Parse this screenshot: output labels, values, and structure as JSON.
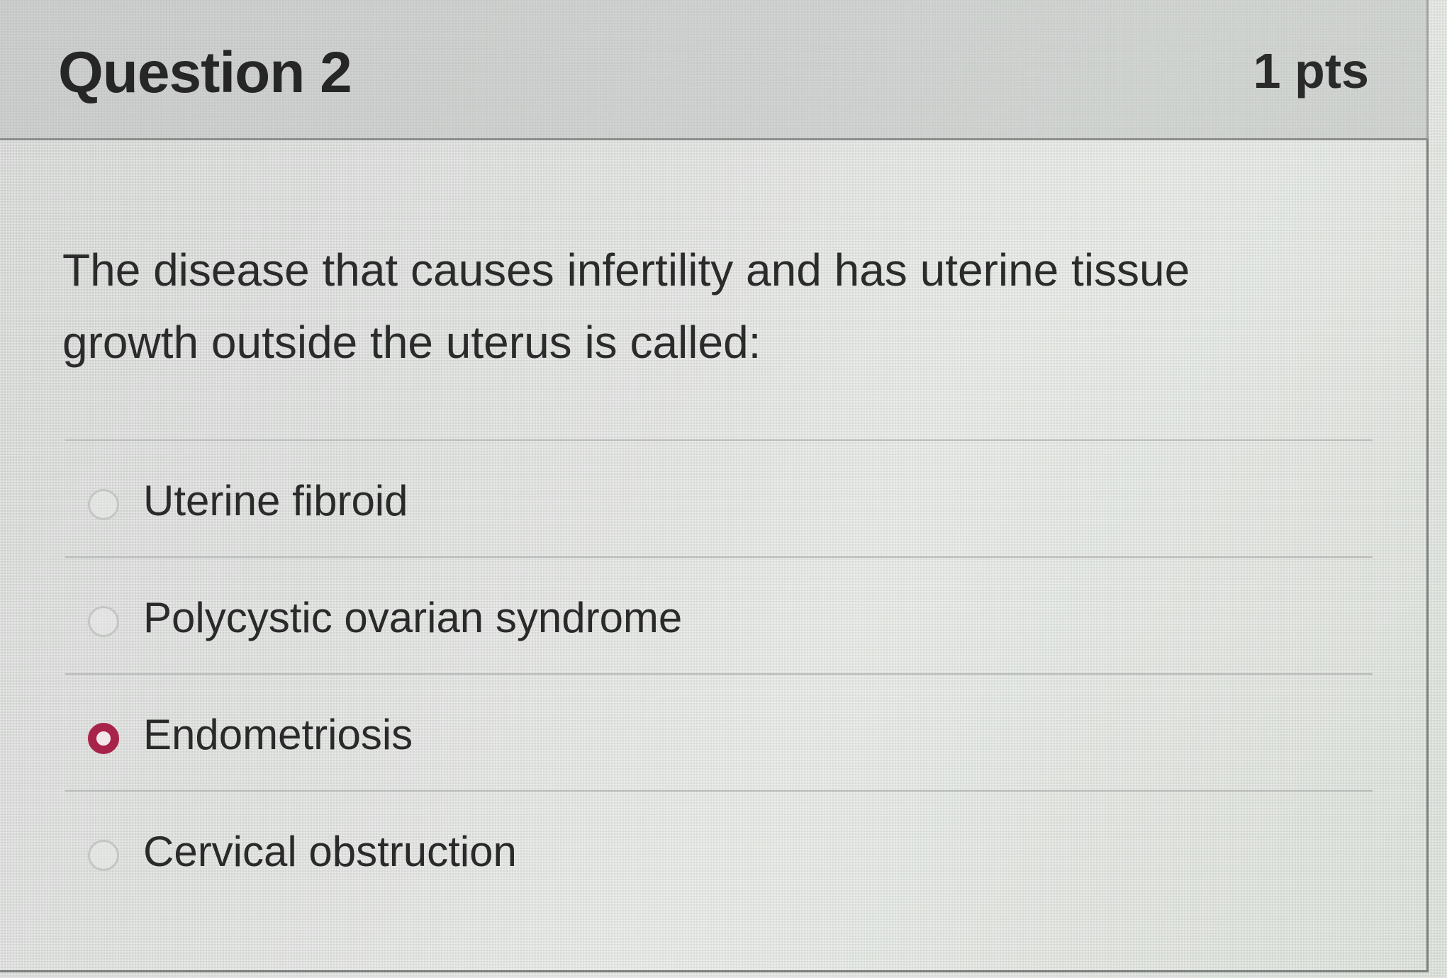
{
  "question": {
    "title": "Question 2",
    "points": "1 pts",
    "text": "The disease that causes infertility and has uterine tissue growth outside the uterus is called:"
  },
  "answers": [
    {
      "label": "Uterine fibroid",
      "selected": false
    },
    {
      "label": "Polycystic ovarian syndrome",
      "selected": false
    },
    {
      "label": "Endometriosis",
      "selected": true
    },
    {
      "label": "Cervical obstruction",
      "selected": false
    }
  ],
  "colors": {
    "selected_radio": "#a8234a",
    "text": "#2a2a2a",
    "border": "#8a8d8b"
  }
}
